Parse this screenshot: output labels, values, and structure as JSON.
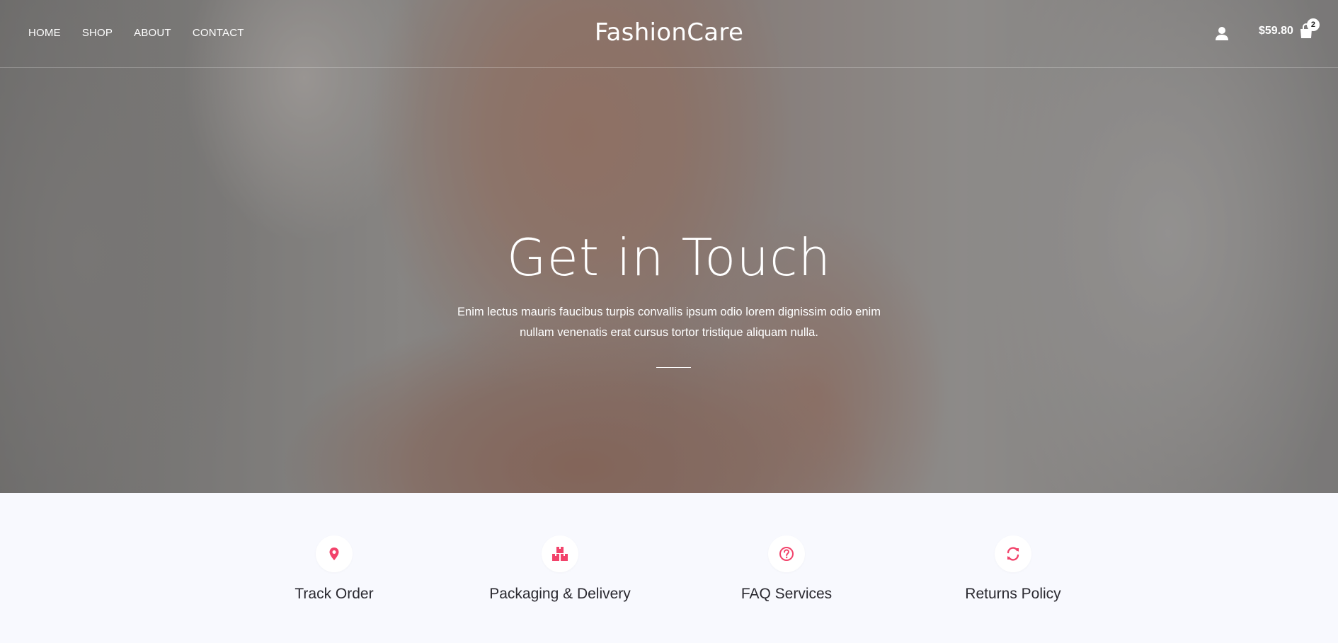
{
  "header": {
    "nav": [
      {
        "label": "HOME"
      },
      {
        "label": "SHOP"
      },
      {
        "label": "ABOUT"
      },
      {
        "label": "CONTACT"
      }
    ],
    "logo": "FashionCare",
    "user_icon": "user-icon",
    "cart": {
      "total": "$59.80",
      "count": "2",
      "icon": "shopping-bag-icon"
    }
  },
  "hero": {
    "title": "Get in Touch",
    "text": "Enim lectus mauris faucibus turpis convallis ipsum odio lorem dignissim odio enim nullam venenatis erat cursus tortor tristique aliquam nulla."
  },
  "features": [
    {
      "label": "Track Order",
      "icon": "map-pin-icon"
    },
    {
      "label": "Packaging & Delivery",
      "icon": "boxes-icon"
    },
    {
      "label": "FAQ Services",
      "icon": "question-circle-icon"
    },
    {
      "label": "Returns Policy",
      "icon": "refresh-icon"
    }
  ],
  "colors": {
    "accent": "#f2436b",
    "features_background": "#f8f9fe",
    "text_dark": "#2a2930"
  }
}
